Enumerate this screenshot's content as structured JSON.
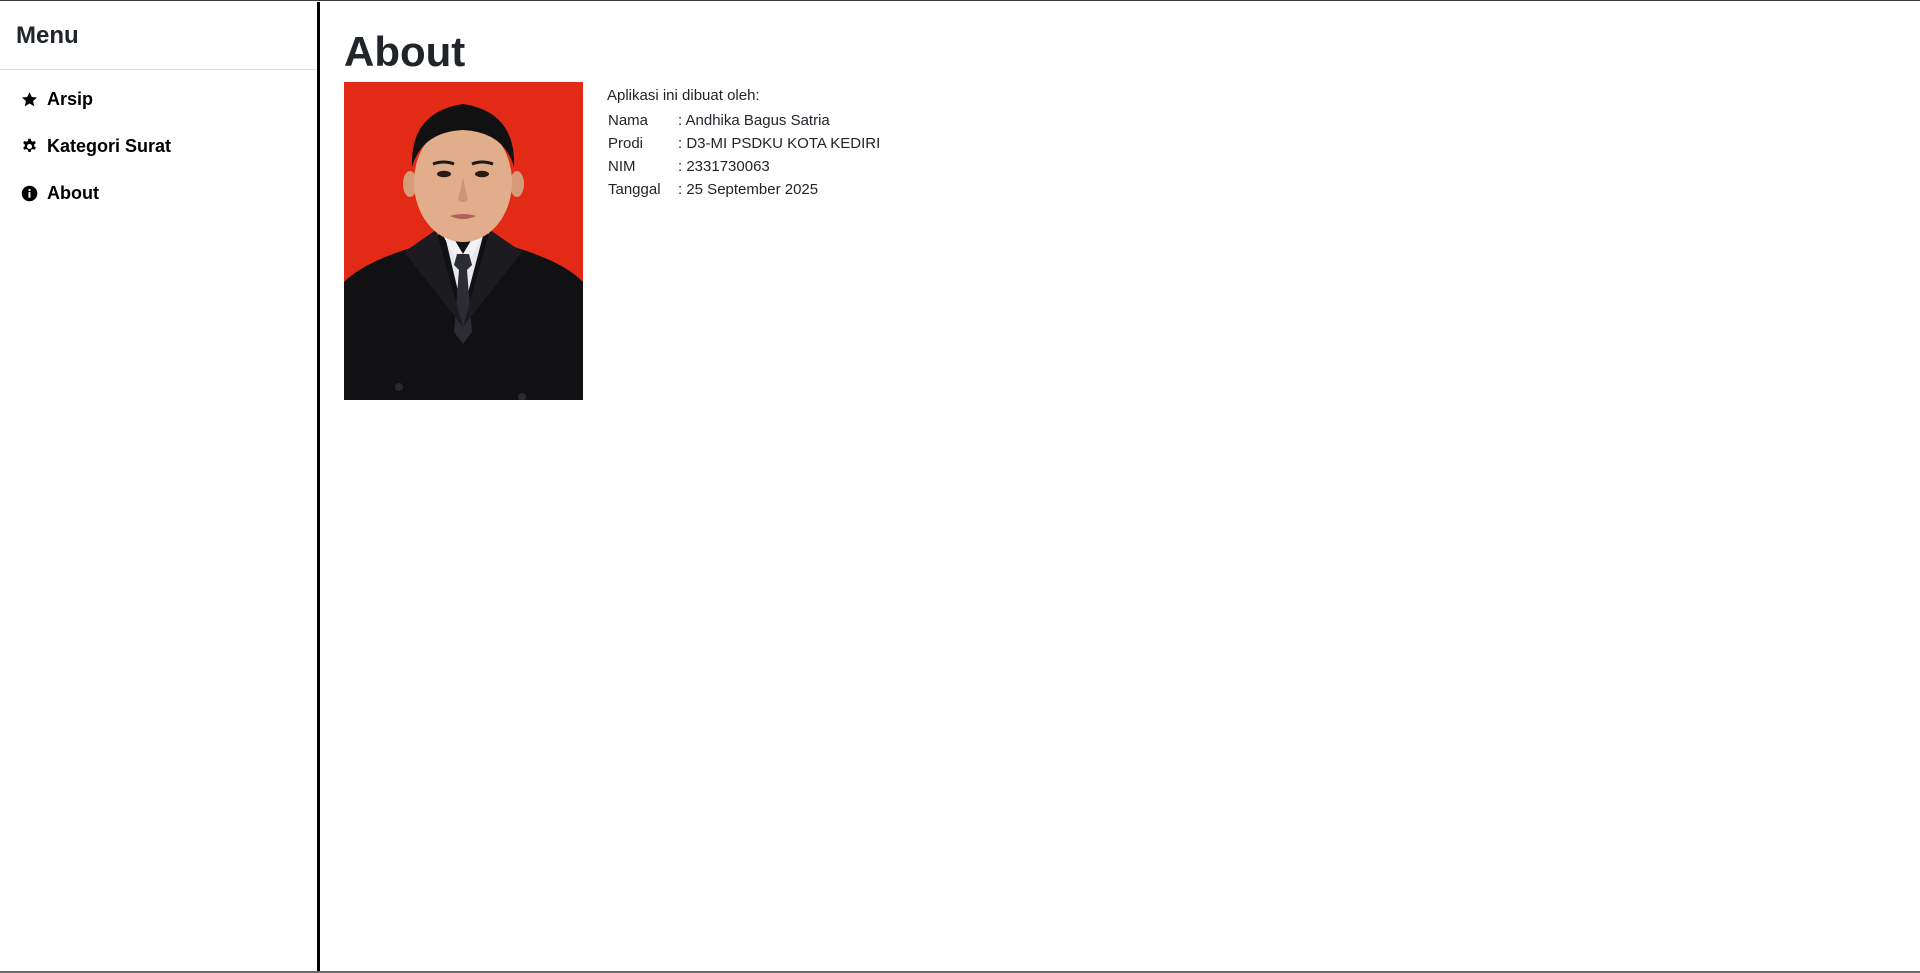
{
  "sidebar": {
    "title": "Menu",
    "items": [
      {
        "label": "Arsip",
        "icon": "star-icon"
      },
      {
        "label": "Kategori Surat",
        "icon": "gear-icon"
      },
      {
        "label": "About",
        "icon": "info-icon"
      }
    ]
  },
  "main": {
    "title": "About",
    "photo": "profile-photo",
    "intro": "Aplikasi ini dibuat oleh:",
    "details": [
      {
        "key": "Nama",
        "value": ": Andhika Bagus Satria"
      },
      {
        "key": "Prodi",
        "value": ": D3-MI PSDKU KOTA KEDIRI"
      },
      {
        "key": "NIM",
        "value": ": 2331730063"
      },
      {
        "key": "Tanggal",
        "value": ": 25 September 2025"
      }
    ]
  },
  "colors": {
    "photo_background": "#e32a17",
    "text": "#212529",
    "sidebar_border": "#000000"
  }
}
